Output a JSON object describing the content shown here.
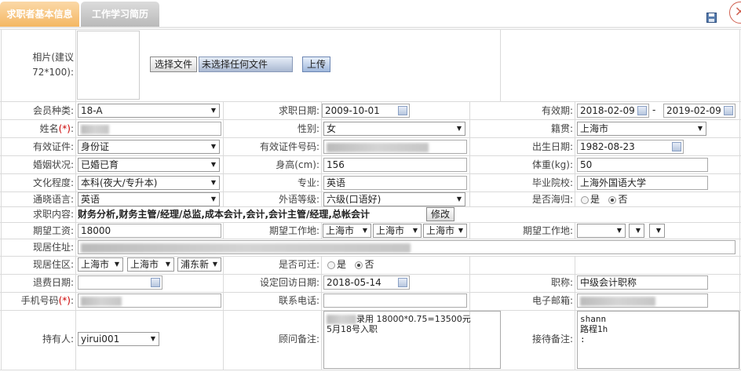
{
  "tabs": [
    "求职者基本信息",
    "工作学习简历"
  ],
  "icons": {
    "save": "save-disk-icon",
    "close": "close-circle-icon",
    "calendar": "calendar-icon"
  },
  "photo": {
    "label_line1": "相片(建议",
    "label_line2": "72*100):",
    "choose_file": "选择文件",
    "no_file": "未选择任何文件",
    "upload": "上传"
  },
  "member_type": {
    "label": "会员种类:",
    "value": "18-A"
  },
  "apply_date": {
    "label": "求职日期:",
    "value": "2009-10-01"
  },
  "valid_period": {
    "label": "有效期:",
    "start": "2018-02-09",
    "sep": "-",
    "end": "2019-02-09"
  },
  "name": {
    "label": "姓名",
    "req": "(*)",
    "colon": ":"
  },
  "gender": {
    "label": "性别:",
    "value": "女"
  },
  "native_place": {
    "label": "籍贯:",
    "value": "上海市"
  },
  "id_type": {
    "label": "有效证件:",
    "value": "身份证"
  },
  "id_number": {
    "label": "有效证件号码:"
  },
  "birth_date": {
    "label": "出生日期:",
    "value": "1982-08-23"
  },
  "marital": {
    "label": "婚姻状况:",
    "value": "已婚已育"
  },
  "height": {
    "label": "身高(cm):",
    "value": "156"
  },
  "weight": {
    "label": "体重(kg):",
    "value": "50"
  },
  "education": {
    "label": "文化程度:",
    "value": "本科(夜大/专升本)"
  },
  "major": {
    "label": "专业:",
    "value": "英语"
  },
  "school": {
    "label": "毕业院校:",
    "value": "上海外国语大学"
  },
  "language": {
    "label": "通晓语言:",
    "value": "英语"
  },
  "language_level": {
    "label": "外语等级:",
    "value": "六级(口语好)"
  },
  "overseas": {
    "label": "是否海归:",
    "yes": "是",
    "no": "否"
  },
  "job_content": {
    "label": "求职内容:",
    "value": "财务分析,财务主管/经理/总监,成本会计,会计,会计主管/经理,总帐会计",
    "modify": "修改"
  },
  "salary": {
    "label": "期望工资:",
    "value": "18000"
  },
  "work_location": {
    "label": "期望工作地:",
    "province": "上海市",
    "city": "上海市",
    "district": "上海市"
  },
  "work_location2": {
    "label": "期望工作地:"
  },
  "address": {
    "label": "现居住址:"
  },
  "residence": {
    "label": "现居住区:",
    "province": "上海市",
    "city": "上海市",
    "district": "浦东新"
  },
  "relocate": {
    "label": "是否可迁:",
    "yes": "是",
    "no": "否"
  },
  "refund_date": {
    "label": "退费日期:"
  },
  "revisit_date": {
    "label": "设定回访日期:",
    "value": "2018-05-14"
  },
  "title": {
    "label": "职称:",
    "value": "中级会计职称"
  },
  "mobile": {
    "label": "手机号码",
    "req": "(*)",
    "colon": ":"
  },
  "phone": {
    "label": "联系电话:"
  },
  "email": {
    "label": "电子邮箱:"
  },
  "holder": {
    "label": "持有人:",
    "value": "yirui001"
  },
  "consultant_note": {
    "label": "顾问备注:",
    "line1": "录用 18000*0.75=13500元",
    "line2": "5月18号入职"
  },
  "reception_note": {
    "label": "接待备注:",
    "line1": "shann",
    "line2": "路程1h",
    "line3": ":"
  }
}
